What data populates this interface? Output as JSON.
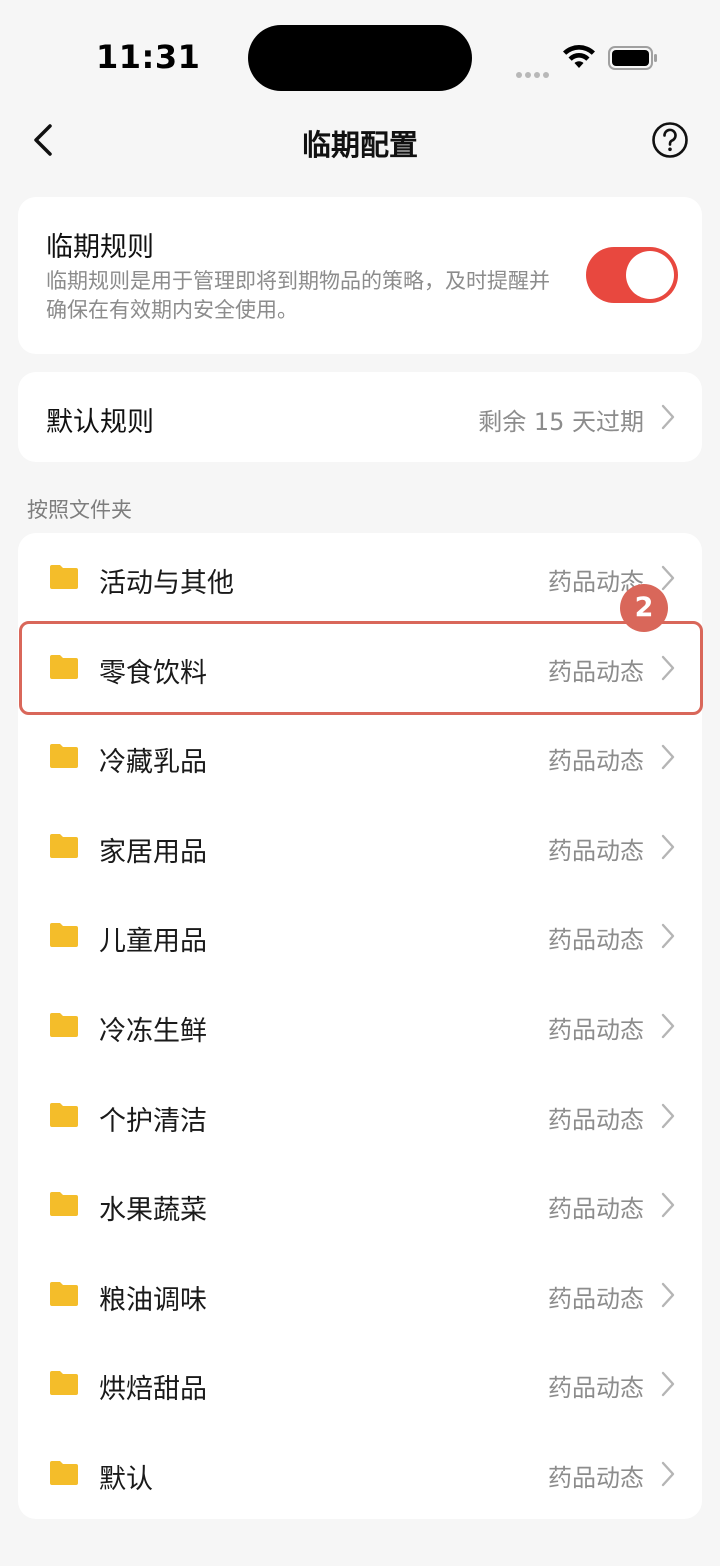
{
  "status_bar": {
    "time": "11:31"
  },
  "nav": {
    "title": "临期配置"
  },
  "rule": {
    "title": "临期规则",
    "description": "临期规则是用于管理即将到期物品的策略，及时提醒并确保在有效期内安全使用。",
    "enabled": true
  },
  "default_rule": {
    "label": "默认规则",
    "value": "剩余 15 天过期"
  },
  "folders_section": {
    "label": "按照文件夹",
    "items": [
      {
        "name": "活动与其他",
        "value": "药品动态"
      },
      {
        "name": "零食饮料",
        "value": "药品动态"
      },
      {
        "name": "冷藏乳品",
        "value": "药品动态"
      },
      {
        "name": "家居用品",
        "value": "药品动态"
      },
      {
        "name": "儿童用品",
        "value": "药品动态"
      },
      {
        "name": "冷冻生鲜",
        "value": "药品动态"
      },
      {
        "name": "个护清洁",
        "value": "药品动态"
      },
      {
        "name": "水果蔬菜",
        "value": "药品动态"
      },
      {
        "name": "粮油调味",
        "value": "药品动态"
      },
      {
        "name": "烘焙甜品",
        "value": "药品动态"
      },
      {
        "name": "默认",
        "value": "药品动态"
      }
    ]
  },
  "annotation": {
    "step": "2"
  },
  "colors": {
    "accent": "#e8483f",
    "folder": "#f4bd2a",
    "highlight": "#d9675a",
    "secondary_text": "#8c8c8c",
    "background": "#f6f6f6"
  }
}
